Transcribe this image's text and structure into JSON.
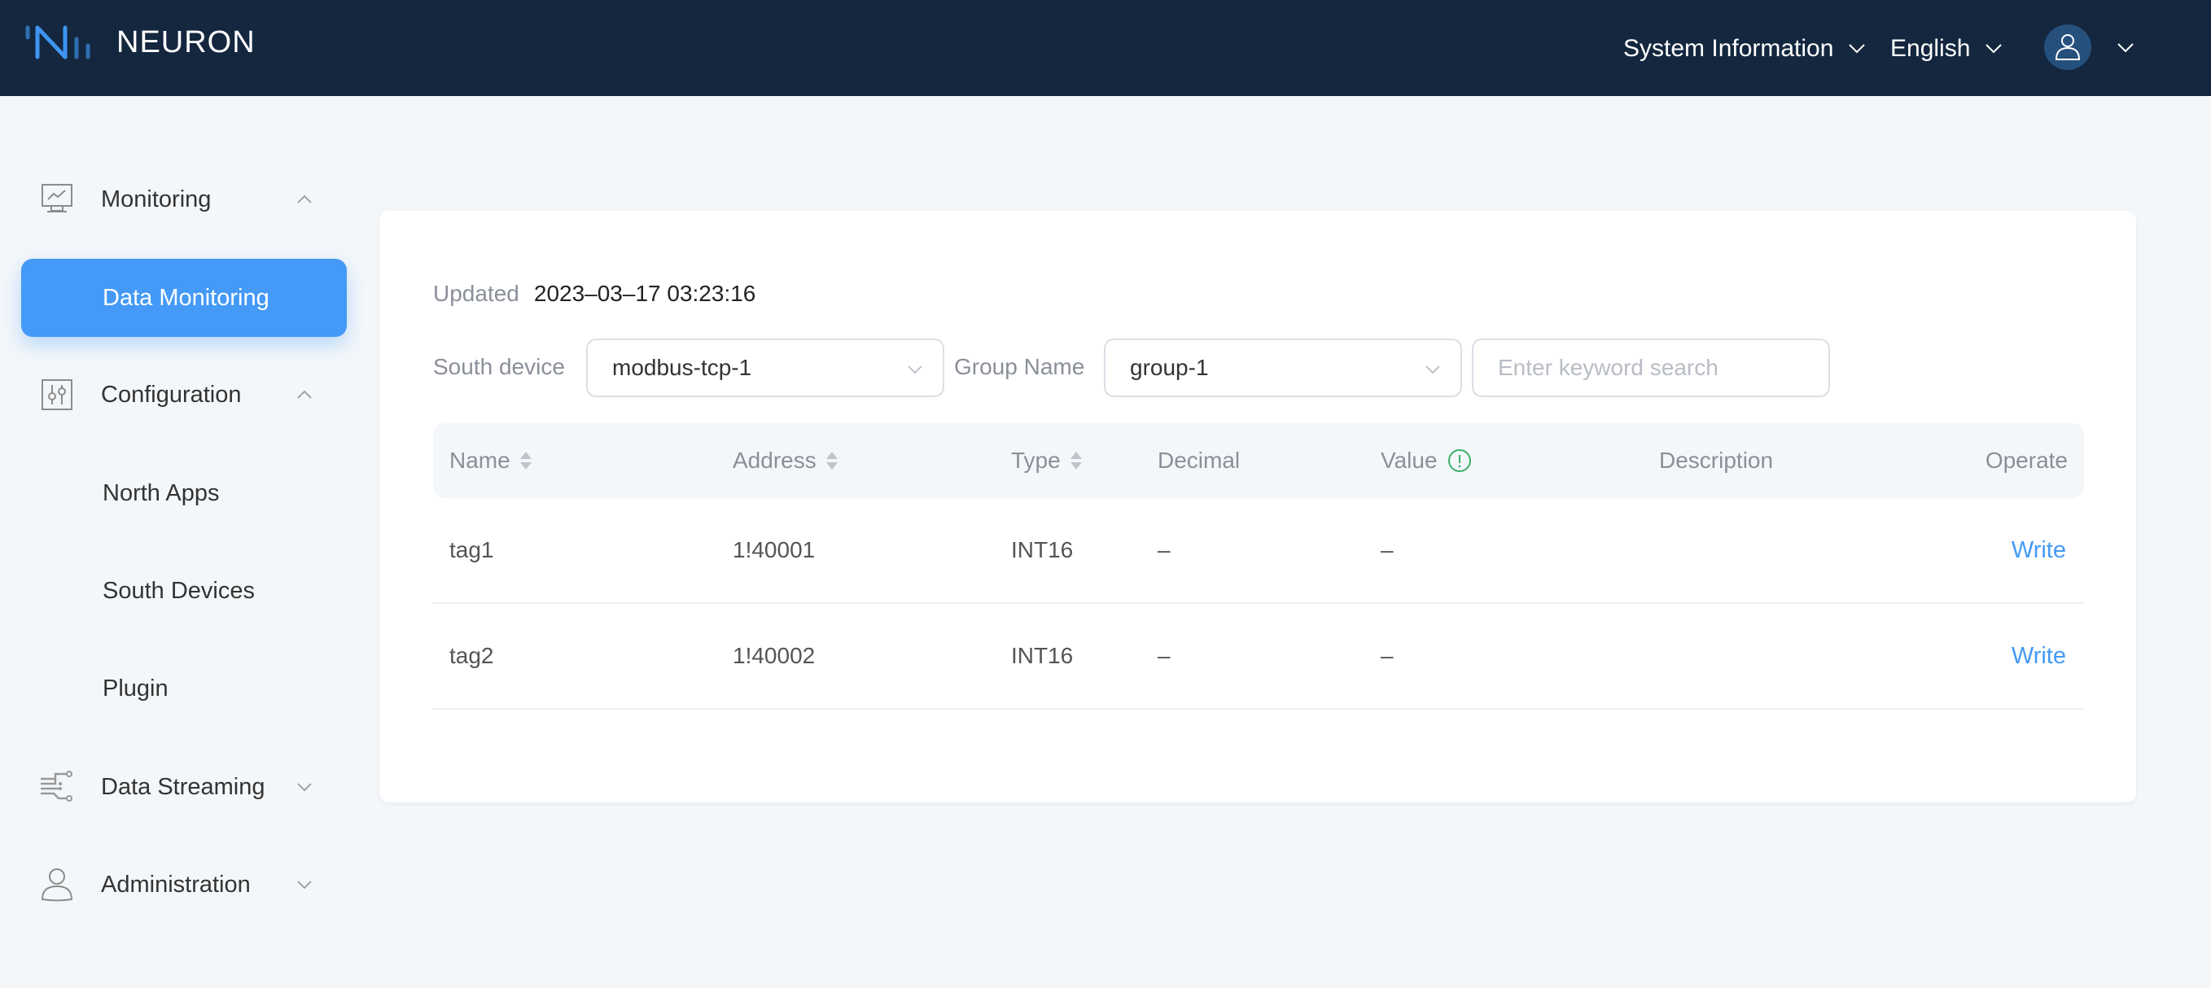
{
  "header": {
    "brand": "NEURON",
    "system_info_label": "System Information",
    "language_label": "English",
    "colors": {
      "header_bg": "#14273f",
      "accent": "#449af6",
      "avatar_bg": "#26507c"
    }
  },
  "sidebar": {
    "groups": [
      {
        "label": "Monitoring",
        "icon": "monitor-chart-icon",
        "expanded": true,
        "items": [
          {
            "label": "Data Monitoring",
            "active": true
          }
        ]
      },
      {
        "label": "Configuration",
        "icon": "sliders-icon",
        "expanded": true,
        "items": [
          {
            "label": "North Apps"
          },
          {
            "label": "South Devices"
          },
          {
            "label": "Plugin"
          }
        ]
      },
      {
        "label": "Data Streaming",
        "icon": "data-stream-icon",
        "expanded": false,
        "items": []
      },
      {
        "label": "Administration",
        "icon": "user-icon",
        "expanded": false,
        "items": []
      }
    ]
  },
  "main": {
    "updated_label": "Updated",
    "updated_value": "2023–03–17 03:23:16",
    "filters": {
      "south_device_label": "South device",
      "south_device_value": "modbus-tcp-1",
      "group_name_label": "Group Name",
      "group_name_value": "group-1",
      "search_placeholder": "Enter keyword search",
      "search_value": ""
    },
    "table": {
      "columns": [
        "Name",
        "Address",
        "Type",
        "Decimal",
        "Value",
        "Description",
        "Operate"
      ],
      "rows": [
        {
          "name": "tag1",
          "address": "1!40001",
          "type": "INT16",
          "decimal": "–",
          "value": "–",
          "description": "",
          "operate": "Write"
        },
        {
          "name": "tag2",
          "address": "1!40002",
          "type": "INT16",
          "decimal": "–",
          "value": "–",
          "description": "",
          "operate": "Write"
        }
      ]
    }
  }
}
